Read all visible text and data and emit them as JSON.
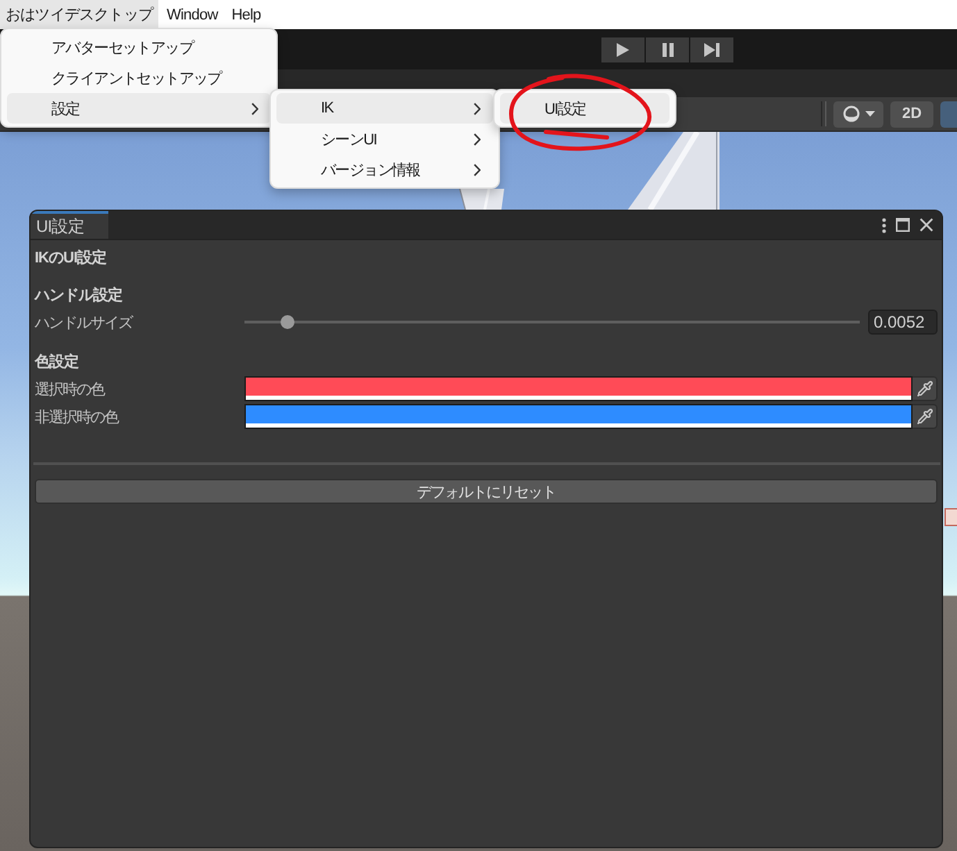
{
  "menu_bar": {
    "items": [
      {
        "label": "おはツイデスクトップ",
        "selected": true
      },
      {
        "label": "Window",
        "selected": false
      },
      {
        "label": "Help",
        "selected": false
      }
    ]
  },
  "menus": [
    {
      "items": [
        {
          "label": "アバターセットアップ",
          "selected": false,
          "submenu": false
        },
        {
          "label": "クライアントセットアップ",
          "selected": false,
          "submenu": false
        },
        {
          "label": "設定",
          "selected": true,
          "submenu": true
        }
      ]
    },
    {
      "items": [
        {
          "label": "IK",
          "selected": true,
          "submenu": true
        },
        {
          "label": "シーンUI",
          "selected": false,
          "submenu": true
        },
        {
          "label": "バージョン情報",
          "selected": false,
          "submenu": true
        }
      ]
    },
    {
      "items": [
        {
          "label": "UI設定",
          "selected": true,
          "submenu": false
        }
      ]
    }
  ],
  "annotations": [
    {
      "kind": "hand_drawn_circle"
    }
  ],
  "play_controls": [
    {
      "kind": "play"
    },
    {
      "kind": "pause"
    },
    {
      "kind": "step"
    }
  ],
  "scene_toolbar": {
    "buttons": [
      {
        "kind": "shading"
      },
      {
        "kind": "label",
        "label": "2D",
        "on": false
      },
      {
        "kind": "toggle",
        "on": true
      }
    ]
  },
  "window": {
    "tab": {
      "label": "UI設定",
      "selected": true
    },
    "title": "IKのUI設定",
    "sections": [
      {
        "heading": "ハンドル設定",
        "fields": [
          {
            "kind": "slider",
            "label": "ハンドルサイズ",
            "level": 0.06,
            "value": "0.0052"
          }
        ]
      },
      {
        "heading": "色設定",
        "fields": [
          {
            "kind": "color",
            "label": "選択時の色",
            "color": "#ff4b57"
          },
          {
            "kind": "color",
            "label": "非選択時の色",
            "color": "#2e8cff"
          }
        ]
      }
    ],
    "reset_button": "デフォルトにリセット"
  }
}
